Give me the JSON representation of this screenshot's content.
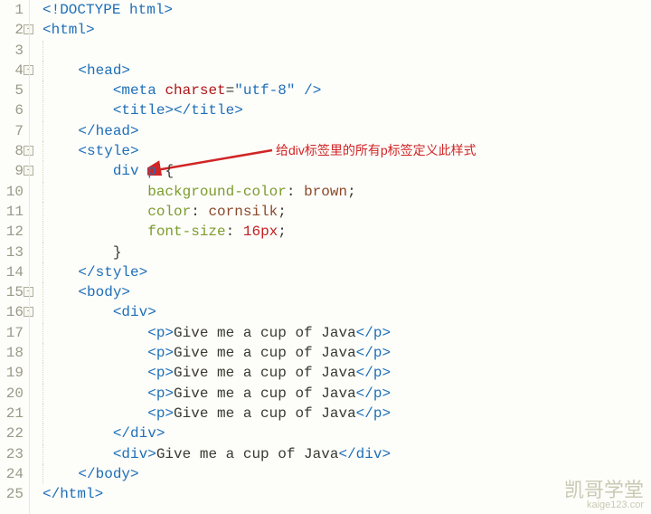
{
  "lines": [
    {
      "n": "1",
      "html": "<span class='tag'>&lt;!DOCTYPE html&gt;</span>",
      "fold": false,
      "guide": false
    },
    {
      "n": "2",
      "html": "<span class='tag'>&lt;html&gt;</span>",
      "fold": true,
      "guide": false
    },
    {
      "n": "3",
      "html": "",
      "fold": false
    },
    {
      "n": "4",
      "html": "    <span class='tag'>&lt;head&gt;</span>",
      "fold": true
    },
    {
      "n": "5",
      "html": "        <span class='tag'>&lt;meta</span> <span class='attr'>charset</span><span class='punct'>=</span><span class='str'>\"utf-8\"</span> <span class='tag'>/&gt;</span>",
      "fold": false
    },
    {
      "n": "6",
      "html": "        <span class='tag'>&lt;title&gt;&lt;/title&gt;</span>",
      "fold": false
    },
    {
      "n": "7",
      "html": "    <span class='tag'>&lt;/head&gt;</span>",
      "fold": false
    },
    {
      "n": "8",
      "html": "    <span class='tag'>&lt;style&gt;</span>",
      "fold": true
    },
    {
      "n": "9",
      "html": "        <span class='sel'>div p</span> <span class='punct'>{</span>",
      "fold": true
    },
    {
      "n": "10",
      "html": "            <span class='prop'>background-color</span><span class='punct'>:</span> <span class='val'>brown</span><span class='punct'>;</span>",
      "fold": false
    },
    {
      "n": "11",
      "html": "            <span class='prop'>color</span><span class='punct'>:</span> <span class='val'>cornsilk</span><span class='punct'>;</span>",
      "fold": false
    },
    {
      "n": "12",
      "html": "            <span class='prop'>font-size</span><span class='punct'>:</span> <span class='num'>16px</span><span class='punct'>;</span>",
      "fold": false
    },
    {
      "n": "13",
      "html": "        <span class='punct'>}</span>",
      "fold": false
    },
    {
      "n": "14",
      "html": "    <span class='tag'>&lt;/style&gt;</span>",
      "fold": false
    },
    {
      "n": "15",
      "html": "    <span class='tag'>&lt;body&gt;</span>",
      "fold": true
    },
    {
      "n": "16",
      "html": "        <span class='tag'>&lt;div&gt;</span>",
      "fold": true
    },
    {
      "n": "17",
      "html": "            <span class='tag'>&lt;p&gt;</span><span class='txt'>Give me a cup of Java</span><span class='tag'>&lt;/p&gt;</span>",
      "fold": false
    },
    {
      "n": "18",
      "html": "            <span class='tag'>&lt;p&gt;</span><span class='txt'>Give me a cup of Java</span><span class='tag'>&lt;/p&gt;</span>",
      "fold": false
    },
    {
      "n": "19",
      "html": "            <span class='tag'>&lt;p&gt;</span><span class='txt'>Give me a cup of Java</span><span class='tag'>&lt;/p&gt;</span>",
      "fold": false
    },
    {
      "n": "20",
      "html": "            <span class='tag'>&lt;p&gt;</span><span class='txt'>Give me a cup of Java</span><span class='tag'>&lt;/p&gt;</span>",
      "fold": false
    },
    {
      "n": "21",
      "html": "            <span class='tag'>&lt;p&gt;</span><span class='txt'>Give me a cup of Java</span><span class='tag'>&lt;/p&gt;</span>",
      "fold": false
    },
    {
      "n": "22",
      "html": "        <span class='tag'>&lt;/div&gt;</span>",
      "fold": false
    },
    {
      "n": "23",
      "html": "        <span class='tag'>&lt;div&gt;</span><span class='txt'>Give me a cup of Java</span><span class='tag'>&lt;/div&gt;</span>",
      "fold": false
    },
    {
      "n": "24",
      "html": "    <span class='tag'>&lt;/body&gt;</span>",
      "fold": false
    },
    {
      "n": "25",
      "html": "<span class='tag'>&lt;/html&gt;</span>",
      "fold": false,
      "guide": false
    }
  ],
  "annotation": {
    "text": "给div标签里的所有p标签定义此样式"
  },
  "watermark": {
    "title": "凯哥学堂",
    "url": "kaige123.cor"
  }
}
